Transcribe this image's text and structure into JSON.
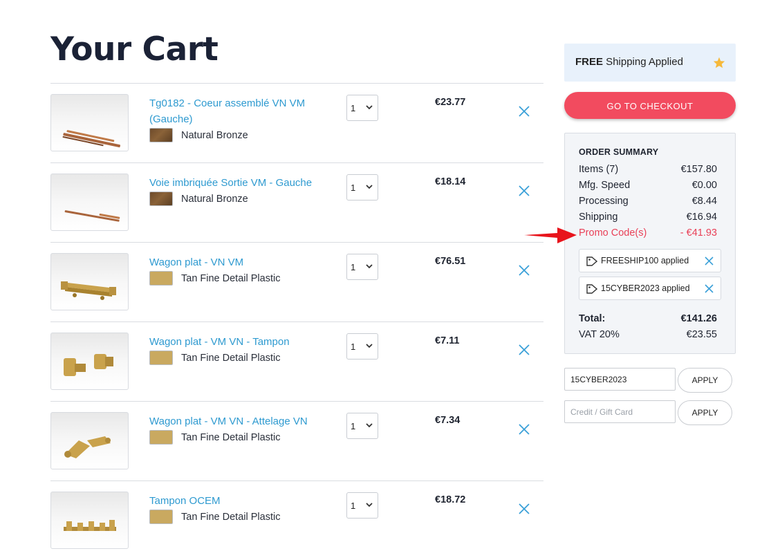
{
  "page": {
    "title": "Your Cart"
  },
  "cart": {
    "items": [
      {
        "name": "Tg0182 - Coeur assemblé VN VM (Gauche)",
        "material": "Natural Bronze",
        "swatch": "bronze",
        "qty": "1",
        "price": "€23.77",
        "thumbnail_icon": "rail-bronze-icon"
      },
      {
        "name": "Voie imbriquée Sortie VM - Gauche",
        "material": "Natural Bronze",
        "swatch": "bronze",
        "qty": "1",
        "price": "€18.14",
        "thumbnail_icon": "rail-bronze-icon"
      },
      {
        "name": "Wagon plat - VN VM",
        "material": "Tan Fine Detail Plastic",
        "swatch": "tan",
        "qty": "1",
        "price": "€76.51",
        "thumbnail_icon": "flat-wagon-icon"
      },
      {
        "name": "Wagon plat - VM VN - Tampon",
        "material": "Tan Fine Detail Plastic",
        "swatch": "tan",
        "qty": "1",
        "price": "€7.11",
        "thumbnail_icon": "buffer-parts-icon"
      },
      {
        "name": "Wagon plat - VM VN - Attelage VN",
        "material": "Tan Fine Detail Plastic",
        "swatch": "tan",
        "qty": "1",
        "price": "€7.34",
        "thumbnail_icon": "coupling-parts-icon"
      },
      {
        "name": "Tampon OCEM",
        "material": "Tan Fine Detail Plastic",
        "swatch": "tan",
        "qty": "1",
        "price": "€18.72",
        "thumbnail_icon": "buffer-set-icon"
      }
    ]
  },
  "shipping_banner": {
    "bold": "FREE",
    "text": " Shipping Applied",
    "icon": "star-icon"
  },
  "checkout": {
    "label": "GO TO CHECKOUT"
  },
  "summary": {
    "heading": "ORDER SUMMARY",
    "rows": [
      {
        "label": "Items (7)",
        "value": "€157.80"
      },
      {
        "label": "Mfg. Speed",
        "value": "€0.00"
      },
      {
        "label": "Processing",
        "value": "€8.44"
      },
      {
        "label": "Shipping",
        "value": "€16.94"
      },
      {
        "label": "Promo Code(s)",
        "value": "- €41.93"
      }
    ],
    "promos": [
      {
        "label": "FREESHIP100 applied"
      },
      {
        "label": "15CYBER2023 applied"
      }
    ],
    "total": {
      "label": "Total:",
      "value": "€141.26"
    },
    "vat": {
      "label": "VAT 20%",
      "value": "€23.55"
    }
  },
  "promo_input": {
    "value": "15CYBER2023",
    "apply_label": "APPLY"
  },
  "gift_input": {
    "placeholder": "Credit / Gift Card",
    "apply_label": "APPLY"
  },
  "colors": {
    "link": "#2e9ad0",
    "checkout": "#f24b5f",
    "promo": "#e94057",
    "banner": "#e8f1fb",
    "accent_x": "#3aa0d8"
  }
}
